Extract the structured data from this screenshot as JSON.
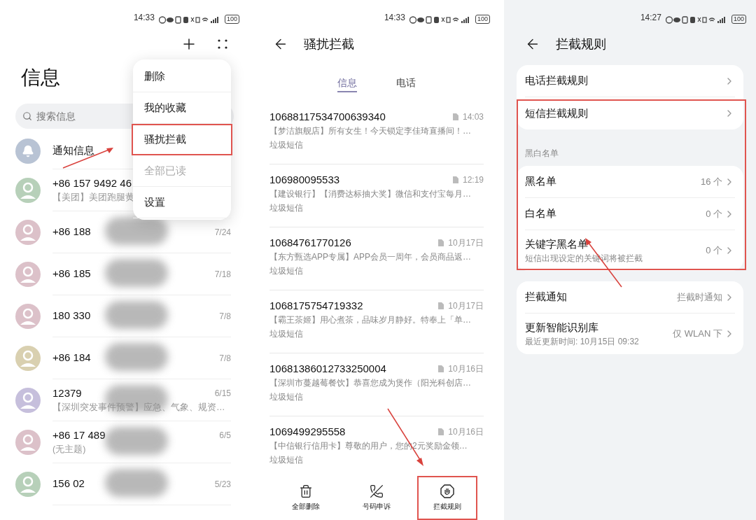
{
  "messages_screen": {
    "status_bar": {
      "time": "14:33",
      "battery": "100"
    },
    "title": "信息",
    "search": {
      "placeholder": "搜索信息"
    },
    "conversations": [
      {
        "kind": "notification",
        "name": "通知信息",
        "color": "#b8c3d4",
        "redacted": false
      },
      {
        "kind": "contact",
        "name": "+86 157 9492 46",
        "preview": "【美团】美团跑腿黄",
        "color": "#b7d0b9",
        "redacted": false
      },
      {
        "kind": "contact",
        "name": "+86 188",
        "date": "7/24",
        "color": "#dcc1c9",
        "redacted": true
      },
      {
        "kind": "contact",
        "name": "+86 185",
        "date": "7/18",
        "color": "#dcc1c9",
        "redacted": true
      },
      {
        "kind": "contact",
        "name": "180 330",
        "date": "7/8",
        "color": "#dcc1c9",
        "redacted": true
      },
      {
        "kind": "contact",
        "name": "+86 184",
        "date": "7/8",
        "color": "#d9d0b0",
        "redacted": true
      },
      {
        "kind": "contact",
        "name": "12379",
        "date": "6/15",
        "preview": "【深圳突发事件预警】应急、气象、规资…",
        "color": "#c6bfdc",
        "redacted": true
      },
      {
        "kind": "contact",
        "name": "+86 17 489",
        "date": "6/5",
        "preview": "(无主题)",
        "color": "#dcc1c9",
        "redacted": true
      },
      {
        "kind": "contact",
        "name": "156 02",
        "date": "5/23",
        "color": "#b7d0b9",
        "redacted": true
      }
    ],
    "menu": [
      {
        "label": "删除",
        "disabled": false,
        "highlighted": false
      },
      {
        "label": "我的收藏",
        "disabled": false,
        "highlighted": false
      },
      {
        "label": "骚扰拦截",
        "disabled": false,
        "highlighted": true
      },
      {
        "label": "全部已读",
        "disabled": true,
        "highlighted": false
      },
      {
        "label": "设置",
        "disabled": false,
        "highlighted": false
      }
    ]
  },
  "harassment_screen": {
    "status_bar": {
      "time": "14:33",
      "battery": "100"
    },
    "title": "骚扰拦截",
    "tabs": [
      {
        "label": "信息",
        "selected": true
      },
      {
        "label": "电话",
        "selected": false
      }
    ],
    "messages": [
      {
        "number": "10688117534700639340",
        "time": "14:03",
        "preview": "【梦洁旗舰店】所有女生！今天锁定李佳琦直播间！…",
        "tag": "垃圾短信"
      },
      {
        "number": "106980095533",
        "time": "12:19",
        "preview": "【建设银行】【消费达标抽大奖】微信和支付宝每月…",
        "tag": "垃圾短信"
      },
      {
        "number": "10684761770126",
        "time": "10月17日",
        "preview": "【东方甄选APP专属】APP会员一周年，会员商品返…",
        "tag": "垃圾短信"
      },
      {
        "number": "1068175754719332",
        "time": "10月17日",
        "preview": "【霸王茶姬】用心煮茶，品味岁月静好。特奉上「单…",
        "tag": "垃圾短信"
      },
      {
        "number": "10681386012733250004",
        "time": "10月16日",
        "preview": "【深圳市蔓越莓餐饮】恭喜您成为煲作（阳光科创店…",
        "tag": "垃圾短信"
      },
      {
        "number": "1069499295558",
        "time": "10月16日",
        "preview": "【中信银行信用卡】尊敬的用户，您的2元奖励金领…",
        "tag": "垃圾短信"
      }
    ],
    "toolbar": [
      {
        "kind": "trash",
        "label": "全部删除",
        "highlighted": false
      },
      {
        "kind": "phone",
        "label": "号码申诉",
        "highlighted": false
      },
      {
        "kind": "hand",
        "label": "拦截规则",
        "highlighted": true
      }
    ]
  },
  "rules_screen": {
    "status_bar": {
      "time": "14:27",
      "battery": "100"
    },
    "title": "拦截规则",
    "highlight_frame": true,
    "groups": [
      {
        "rows": [
          {
            "title": "电话拦截规则"
          },
          {
            "title": "短信拦截规则"
          }
        ]
      },
      {
        "label": "黑白名单",
        "rows": [
          {
            "title": "黑名单",
            "value": "16 个"
          },
          {
            "title": "白名单",
            "value": "0 个"
          },
          {
            "title": "关键字黑名单",
            "subtitle": "短信出现设定的关键词将被拦截",
            "value": "0 个"
          }
        ]
      },
      {
        "rows": [
          {
            "title": "拦截通知",
            "value": "拦截时通知"
          },
          {
            "title": "更新智能识别库",
            "subtitle": "最近更新时间: 10月15日 09:32",
            "value": "仅 WLAN 下"
          }
        ]
      }
    ]
  }
}
